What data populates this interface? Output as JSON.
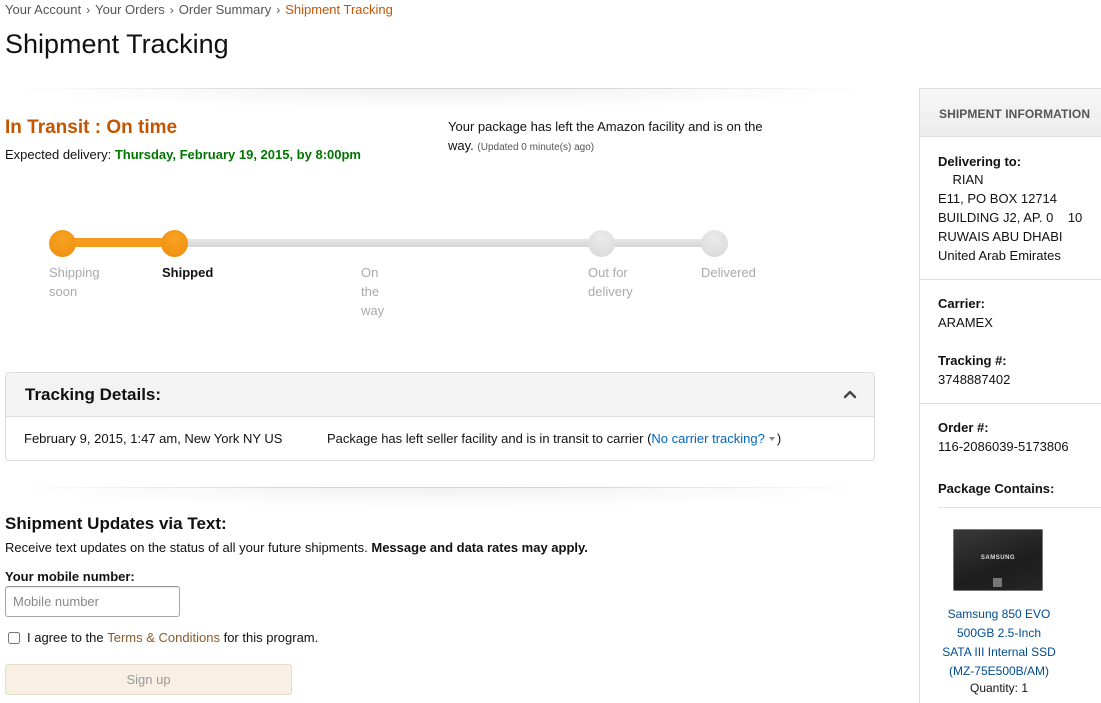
{
  "breadcrumb": [
    {
      "label": "Your Account"
    },
    {
      "label": "Your Orders"
    },
    {
      "label": "Order Summary"
    },
    {
      "label": "Shipment Tracking",
      "current": true
    }
  ],
  "breadcrumb_separator": "›",
  "page_title": "Shipment Tracking",
  "status": {
    "title": "In Transit : On time",
    "expected_label": "Expected delivery: ",
    "expected_date": "Thursday, February 19, 2015, by 8:00pm",
    "message": "Your package has left the Amazon facility and is on the way.",
    "updated": "(Updated 0 minute(s) ago)"
  },
  "tracker": {
    "current_step_index": 1,
    "steps": [
      {
        "label": "Shipping soon",
        "state": "done"
      },
      {
        "label": "Shipped",
        "state": "current"
      },
      {
        "label": "On the way",
        "state": "pending"
      },
      {
        "label": "Out for delivery",
        "state": "pending"
      },
      {
        "label": "Delivered",
        "state": "pending"
      }
    ]
  },
  "tracking_details": {
    "title": "Tracking Details:",
    "collapse_icon": "chevron-up-icon",
    "events": [
      {
        "when": "February 9, 2015, 1:47 am, New York NY US",
        "description": "Package has left seller facility and is in transit to carrier",
        "link_label": "No carrier tracking?"
      }
    ]
  },
  "sms": {
    "title": "Shipment Updates via Text:",
    "description": "Receive text updates on the status of all your future shipments. ",
    "description_bold": "Message and data rates may apply.",
    "mobile_label": "Your mobile number:",
    "mobile_placeholder": "Mobile number",
    "mobile_value": "",
    "agree_prefix": "I agree to the ",
    "agree_link": "Terms & Conditions",
    "agree_suffix": " for this program.",
    "agree_checked": false,
    "signup_label": "Sign up"
  },
  "sidebar": {
    "title": "SHIPMENT INFORMATION",
    "delivering_to_label": "Delivering to:",
    "address_lines": [
      "    RIAN",
      "E11, PO BOX 12714",
      "BUILDING J2, AP. 0    10",
      "RUWAIS ABU DHABI",
      "United Arab Emirates"
    ],
    "carrier_label": "Carrier:",
    "carrier": "ARAMEX",
    "tracking_label": "Tracking #:",
    "tracking_number": "3748887402",
    "order_label": "Order #:",
    "order_number": "116-2086039-5173806",
    "package_label": "Package Contains:",
    "product": {
      "image_brand": "SAMSUNG",
      "name_lines": [
        "Samsung 850 EVO",
        "500GB 2.5-Inch",
        "SATA III Internal SSD",
        "(MZ-75E500B/AM)"
      ],
      "quantity": "Quantity: 1"
    }
  },
  "colors": {
    "accent_orange": "#c45500",
    "progress_orange": "#f69c1d",
    "delivery_green": "#007600",
    "link_blue": "#0066c0"
  }
}
